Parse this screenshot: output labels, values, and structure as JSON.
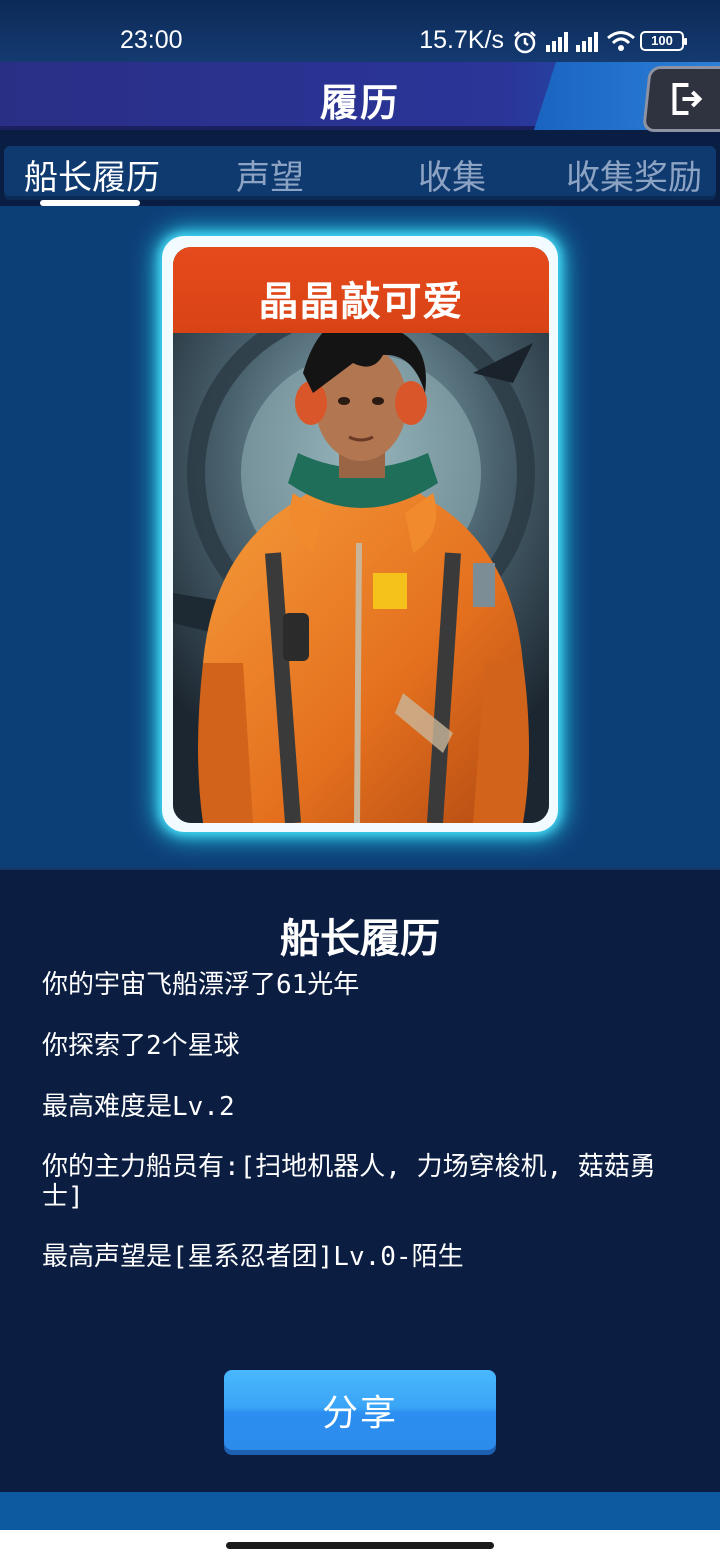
{
  "status_bar": {
    "time": "23:00",
    "net_speed": "15.7K/s",
    "battery": "100",
    "icons": [
      "alarm-icon",
      "signal-hd-icon",
      "signal-hd-icon",
      "wifi-icon",
      "battery-icon"
    ]
  },
  "header": {
    "title": "履历",
    "exit_icon": "exit-icon"
  },
  "tabs": [
    {
      "label": "船长履历",
      "active": true
    },
    {
      "label": "声望",
      "active": false
    },
    {
      "label": "收集",
      "active": false
    },
    {
      "label": "收集奖励",
      "active": false
    }
  ],
  "card": {
    "name": "晶晶敲可爱",
    "image": "captain-portrait"
  },
  "resume": {
    "title": "船长履历",
    "lines": [
      "你的宇宙飞船漂浮了61光年",
      "你探索了2个星球",
      "最高难度是Lv.2",
      "你的主力船员有:[扫地机器人, 力场穿梭机, 菇菇勇士]",
      "最高声望是[星系忍者团]Lv.0-陌生"
    ]
  },
  "share_button": {
    "label": "分享"
  },
  "colors": {
    "tab_bar": "#0f3a70",
    "card_name_bar": "#d84315",
    "card_glow": "#2bd3f2",
    "panel_bg": "#0b1e42",
    "share_button": "#3aa4f6"
  }
}
